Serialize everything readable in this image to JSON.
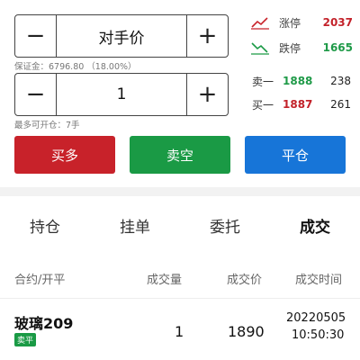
{
  "price_input": {
    "minus": "−",
    "value": "对手价",
    "plus": "+"
  },
  "margin_hint": "保证金：6796.80 （18.00%）",
  "qty_input": {
    "minus": "−",
    "value": "1",
    "plus": "+"
  },
  "max_open_hint": "最多可开仓：7手",
  "limits": {
    "up": {
      "label": "涨停",
      "value": "2037",
      "icon": "trend-up-icon"
    },
    "down": {
      "label": "跌停",
      "value": "1665",
      "icon": "trend-down-icon"
    }
  },
  "depth": {
    "ask": {
      "label": "卖一",
      "price": "1888",
      "volume": "238"
    },
    "bid": {
      "label": "买一",
      "price": "1887",
      "volume": "261"
    }
  },
  "actions": {
    "buy": "买多",
    "sell": "卖空",
    "close": "平仓"
  },
  "tabs": [
    "持仓",
    "挂单",
    "委托",
    "成交"
  ],
  "active_tab": "成交",
  "table": {
    "headers": {
      "contract": "合约/开平",
      "volume": "成交量",
      "price": "成交价",
      "time": "成交时间"
    },
    "rows": [
      {
        "contract": "玻璃209",
        "tag": "卖平",
        "volume": "1",
        "price": "1890",
        "date": "20220505",
        "time": "10:50:30"
      }
    ]
  },
  "colors": {
    "red": "#c8222a",
    "green": "#1a9a45",
    "blue": "#1775d8"
  }
}
